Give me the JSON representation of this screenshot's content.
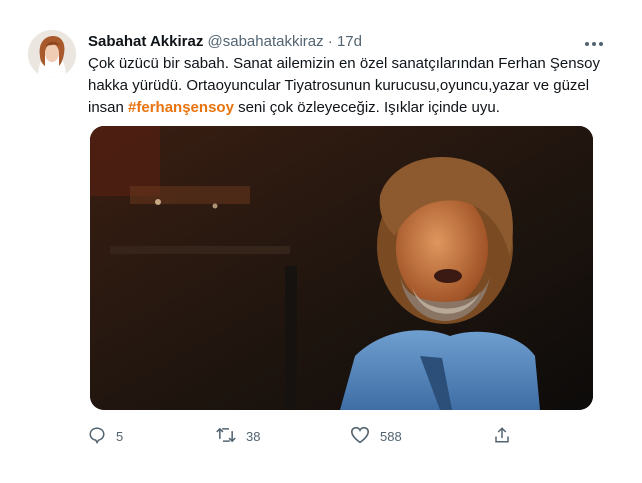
{
  "tweet": {
    "author_name": "Sabahat Akkiraz",
    "handle": "@sabahatakkiraz",
    "separator": "·",
    "time": "17d",
    "text_before_hashtag": "Çok üzücü bir sabah. Sanat ailemizin en özel sanatçılarından Ferhan Şensoy hakka yürüdü. Ortaoyuncular Tiyatrosunun kurucusu,oyuncu,yazar ve güzel insan ",
    "hashtag": "#ferhanşensoy",
    "text_after_hashtag": " seni çok özleyeceğiz. Işıklar içinde uyu.",
    "hashtag_color": "#e8730f"
  },
  "actions": {
    "reply_count": "5",
    "retweet_count": "38",
    "like_count": "588"
  },
  "icons": {
    "more": "more-icon",
    "reply": "reply-icon",
    "retweet": "retweet-icon",
    "like": "heart-icon",
    "share": "share-icon"
  },
  "colors": {
    "text": "#0f1419",
    "muted": "#536471"
  }
}
